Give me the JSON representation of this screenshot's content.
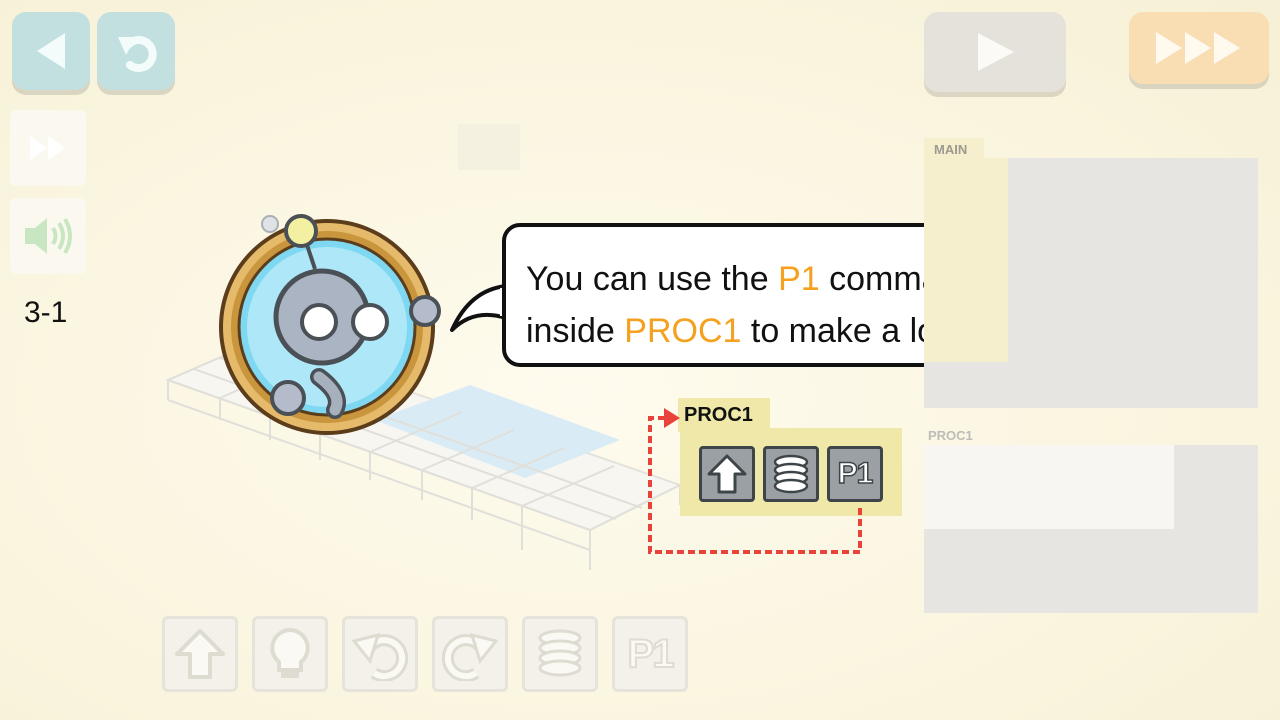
{
  "level": "3-1",
  "hint": {
    "line1_pre": "You can use the ",
    "line1_hl": "P1",
    "line1_post": " command",
    "line2_pre": "inside ",
    "line2_hl": "PROC1",
    "line2_post": " to make a loop!"
  },
  "panel": {
    "main_label": "MAIN",
    "proc_label": "PROC1"
  },
  "proc_card": {
    "title": "PROC1",
    "commands": [
      "up-arrow-icon",
      "spring-icon",
      "P1"
    ]
  },
  "palette": [
    "up-arrow-icon",
    "bulb-icon",
    "turn-left-icon",
    "turn-right-icon",
    "spring-icon",
    "P1"
  ],
  "colors": {
    "highlight": "#f5a01e",
    "loop_arrow": "#e8423a",
    "card": "#efe8a9"
  }
}
